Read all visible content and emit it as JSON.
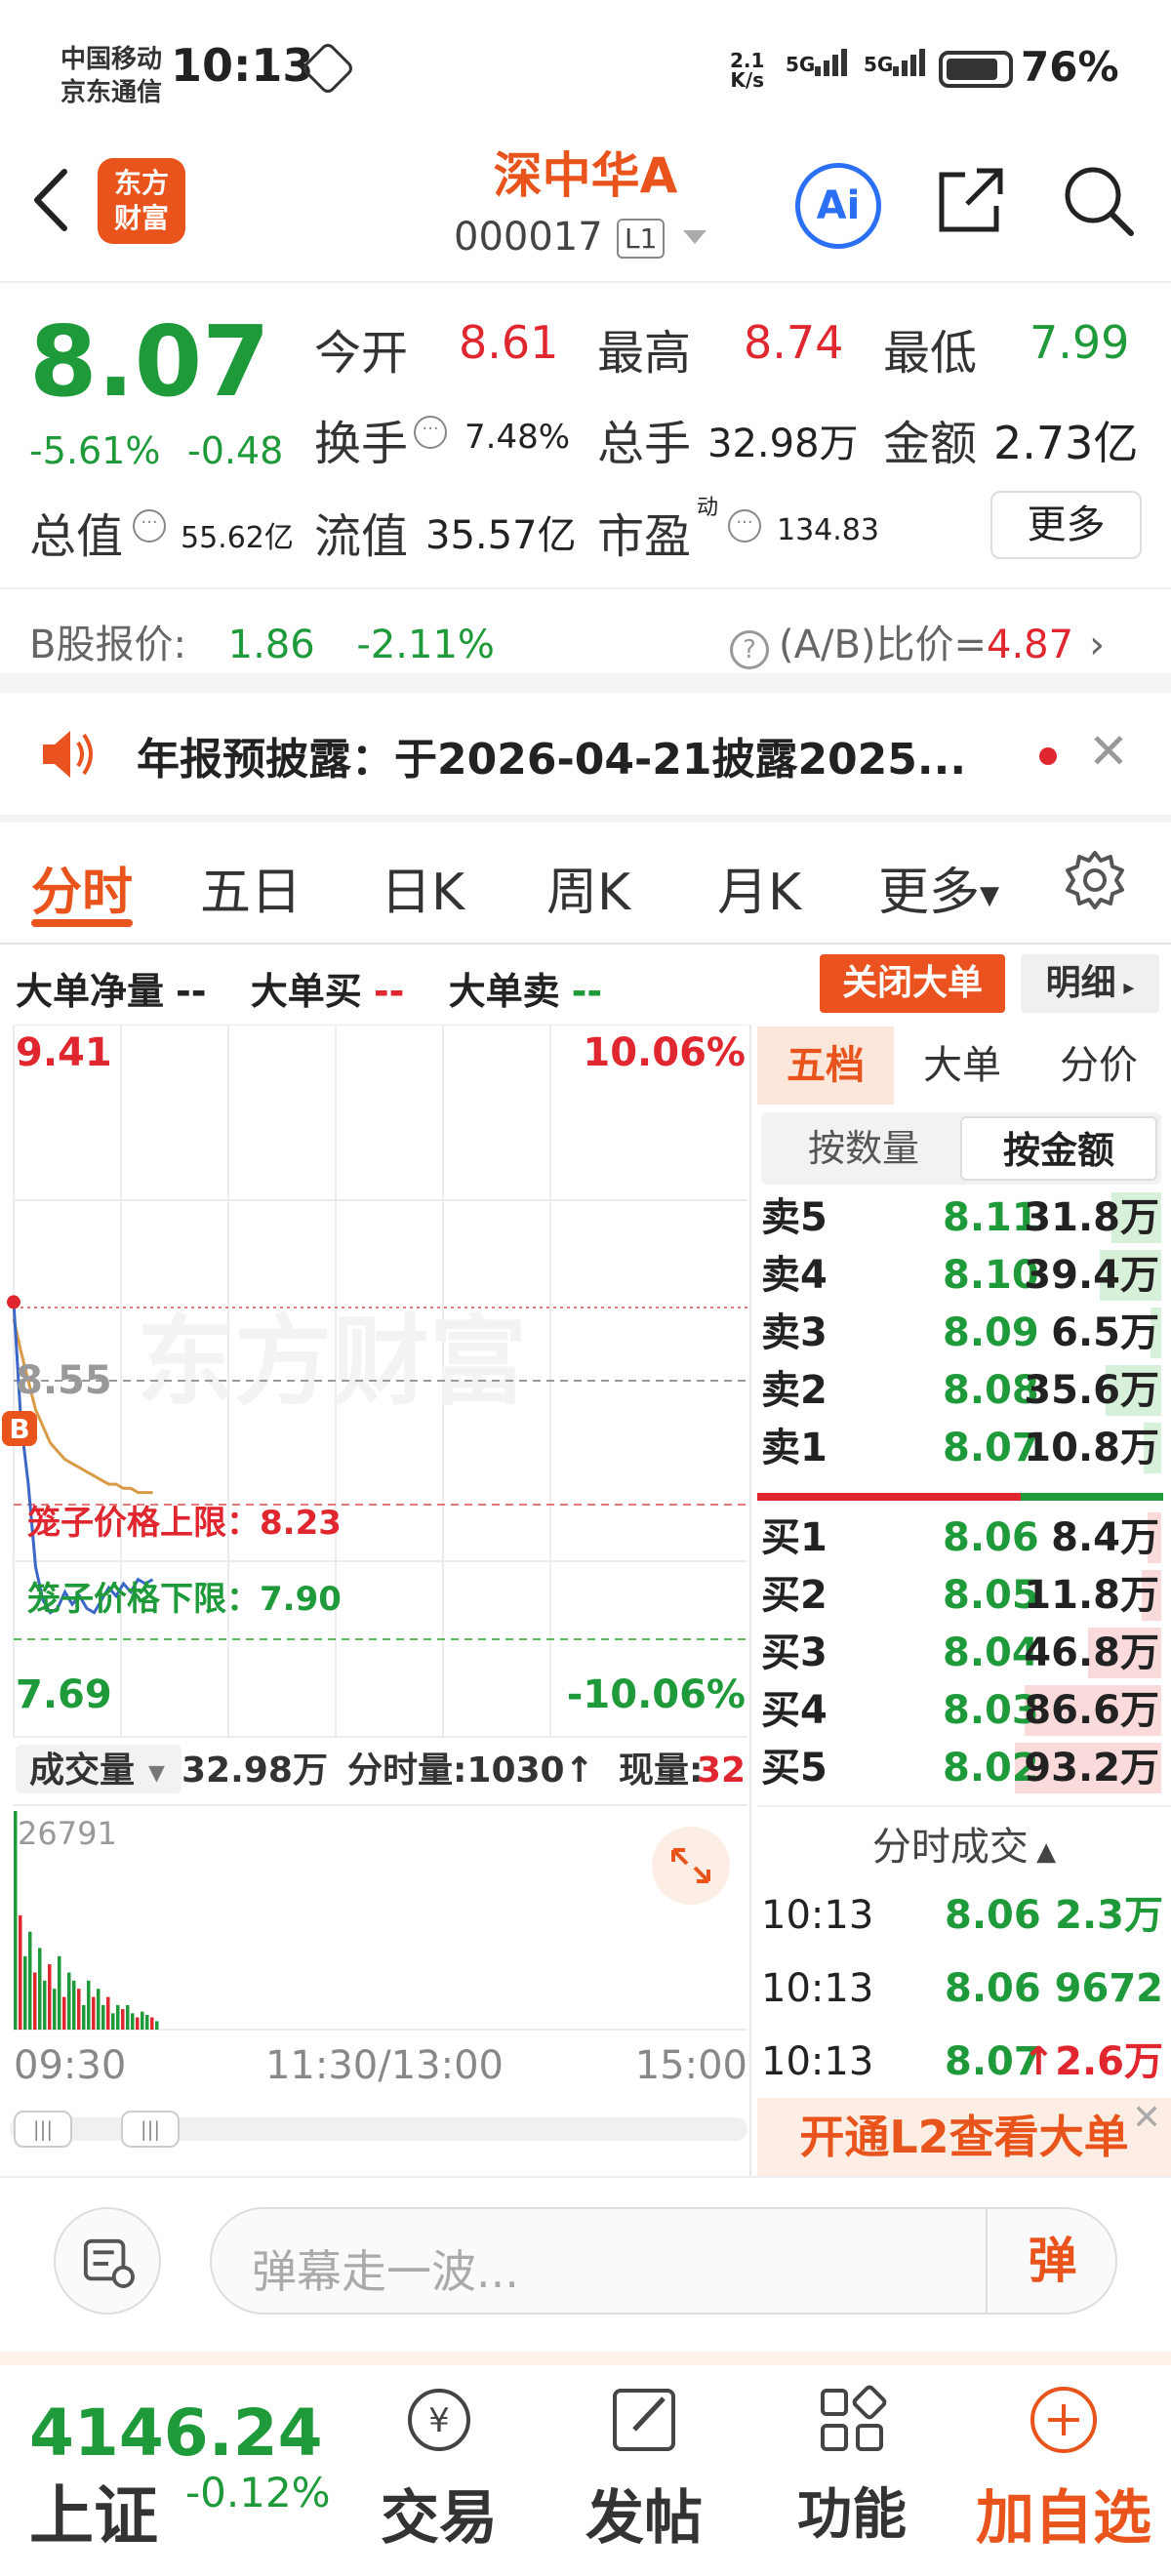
{
  "status_bar": {
    "carrier_1": "中国移动",
    "carrier_2": "京东通信",
    "time": "10:13",
    "net_speed_value": "2.1",
    "net_speed_unit": "K/s",
    "sig1_label": "5G",
    "sig2_label": "5G",
    "battery": "76%"
  },
  "header": {
    "logo_line1": "东方",
    "logo_line2": "财富",
    "stock_name": "深中华A",
    "stock_code": "000017",
    "level_badge": "L1",
    "ai_label": "Ai"
  },
  "quote": {
    "price": "8.07",
    "change_pct": "-5.61%",
    "change": "-0.48",
    "open_label": "今开",
    "open": "8.61",
    "high_label": "最高",
    "high": "8.74",
    "low_label": "最低",
    "low": "7.99",
    "turnover_label": "换手",
    "turnover": "7.48%",
    "volume_label": "总手",
    "volume": "32.98万",
    "amount_label": "金额",
    "amount": "2.73亿",
    "mktcap_label": "总值",
    "mktcap": "55.62亿",
    "float_label": "流值",
    "float": "35.57亿",
    "pe_label": "市盈",
    "pe_sup": "动",
    "pe": "134.83",
    "more_label": "更多",
    "b_label": "B股报价:",
    "b_price": "1.86",
    "b_pct": "-2.11%",
    "ratio_label": "(A/B)比价=",
    "ratio_value": "4.87"
  },
  "notice": {
    "text": "年报预披露：于2026-04-21披露2025..."
  },
  "tabs": [
    "分时",
    "五日",
    "日K",
    "周K",
    "月K",
    "更多"
  ],
  "big_order": {
    "net_label": "大单净量",
    "net_value": "--",
    "buy_label": "大单买",
    "buy_value": "--",
    "sell_label": "大单卖",
    "sell_value": "--",
    "close_button": "关闭大单",
    "detail_button": "明细"
  },
  "chart_labels": {
    "top_price": "9.41",
    "top_pct": "10.06%",
    "mid_price": "8.55",
    "bottom_price": "7.69",
    "bottom_pct": "-10.06%",
    "cage_upper": "笼子价格上限：8.23",
    "cage_lower": "笼子价格下限：7.90",
    "b_marker": "B",
    "watermark": "东方财富",
    "vol_selector": "成交量",
    "vol_total": "32.98万",
    "vol_min": "分时量:1030↑",
    "vol_now_label": "现量:",
    "vol_now": "32",
    "vol_max": "26791",
    "time_start": "09:30",
    "time_mid": "11:30/13:00",
    "time_end": "15:00"
  },
  "chart_data": {
    "type": "line",
    "title": "",
    "ylim": [
      7.69,
      9.41
    ],
    "prev_close": 8.55,
    "series": [
      {
        "values": [
          8.74,
          8.45,
          8.3,
          8.1,
          8.02,
          7.99,
          8.0,
          8.04,
          8.01,
          8.03,
          8.0,
          7.99,
          8.02,
          8.05,
          8.03,
          8.06,
          8.04,
          8.07,
          8.06,
          8.07
        ]
      },
      {
        "values": [
          8.7,
          8.62,
          8.55,
          8.48,
          8.44,
          8.4,
          8.38,
          8.36,
          8.35,
          8.34,
          8.33,
          8.32,
          8.31,
          8.3,
          8.3,
          8.29,
          8.29,
          8.28,
          8.28,
          8.28
        ]
      }
    ],
    "volume": [
      26791,
      14000,
      9000,
      12000,
      7000,
      10000,
      6000,
      8000,
      5000,
      9000,
      4000,
      7000,
      6000,
      5000,
      3000,
      6000,
      4000,
      5000,
      3000,
      4000,
      2000,
      3000,
      2500,
      3000,
      2000,
      1500,
      2200,
      1800,
      1500,
      1030
    ]
  },
  "order_panel": {
    "tabs": [
      "五档",
      "大单",
      "分价"
    ],
    "subtabs": [
      "按数量",
      "按金额"
    ],
    "asks": [
      {
        "label": "卖5",
        "price": "8.11",
        "vol": "31.8万",
        "w": 0.34
      },
      {
        "label": "卖4",
        "price": "8.10",
        "vol": "39.4万",
        "w": 0.42
      },
      {
        "label": "卖3",
        "price": "8.09",
        "vol": "6.5万",
        "w": 0.07
      },
      {
        "label": "卖2",
        "price": "8.08",
        "vol": "35.6万",
        "w": 0.38
      },
      {
        "label": "卖1",
        "price": "8.07",
        "vol": "10.8万",
        "w": 0.12
      }
    ],
    "bids": [
      {
        "label": "买1",
        "price": "8.06",
        "vol": "8.4万",
        "w": 0.09
      },
      {
        "label": "买2",
        "price": "8.05",
        "vol": "11.8万",
        "w": 0.13
      },
      {
        "label": "买3",
        "price": "8.04",
        "vol": "46.8万",
        "w": 0.5
      },
      {
        "label": "买4",
        "price": "8.03",
        "vol": "86.6万",
        "w": 0.93
      },
      {
        "label": "买5",
        "price": "8.02",
        "vol": "93.2万",
        "w": 1.0
      }
    ],
    "ticks_title": "分时成交",
    "ticks": [
      {
        "time": "10:13",
        "price": "8.06",
        "vol": "2.3万"
      },
      {
        "time": "10:13",
        "price": "8.06",
        "vol": "9672"
      },
      {
        "time": "10:13",
        "price": "8.07",
        "vol": "↑2.6万"
      }
    ],
    "l2_banner": "开通L2查看大单"
  },
  "danmu": {
    "placeholder": "弹幕走一波...",
    "send_label": "弹"
  },
  "bottom_nav": {
    "index_value": "4146.24",
    "index_name": "上证",
    "index_pct": "-0.12%",
    "items": [
      "交易",
      "发帖",
      "功能",
      "加自选"
    ]
  },
  "colors": {
    "red": "#e0262f",
    "green": "#1f9a3a",
    "accent": "#e8541c",
    "ai_blue": "#2b6ff4"
  }
}
